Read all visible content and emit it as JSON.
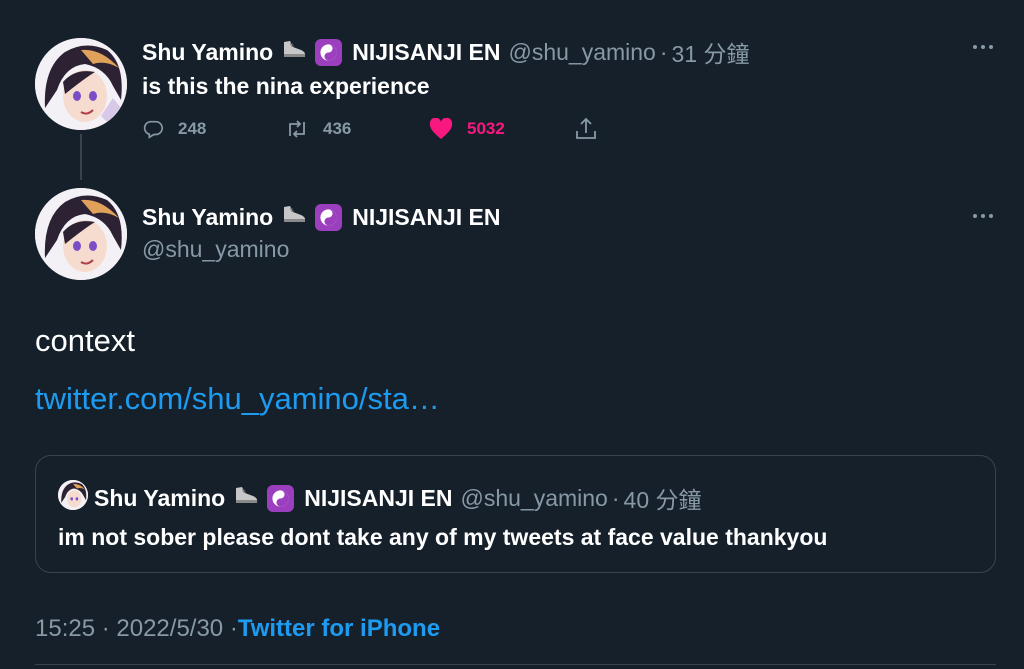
{
  "reply_tweet": {
    "display_name": "Shu Yamino",
    "org": "NIJISANJI EN",
    "handle": "@shu_yamino",
    "separator": "·",
    "time": "31 分鐘",
    "text": "is this the nina experience",
    "reply_count": "248",
    "retweet_count": "436",
    "like_count": "5032",
    "liked": true
  },
  "main_tweet": {
    "display_name": "Shu Yamino",
    "org": "NIJISANJI EN",
    "handle": "@shu_yamino",
    "text": "context",
    "link": "twitter.com/shu_yamino/sta…",
    "timestamp": "15:25 · 2022/5/30 · ",
    "source": "Twitter for iPhone"
  },
  "quoted_tweet": {
    "display_name": "Shu Yamino",
    "org": "NIJISANJI EN",
    "handle": "@shu_yamino",
    "separator": "·",
    "time": "40 分鐘",
    "text": "im not sober please dont take any of my tweets at face value thankyou"
  },
  "icons": {
    "emoji_1": "shoe-icon",
    "emoji_2": "yin-yang-icon",
    "reply": "reply-icon",
    "retweet": "retweet-icon",
    "like": "heart-icon",
    "share": "share-icon",
    "more": "more-icon"
  },
  "colors": {
    "background": "#15202b",
    "secondary_text": "#8899a6",
    "link": "#1d9bf0",
    "like": "#f91880",
    "border": "#38444d",
    "badge": "#9b3fbf"
  }
}
